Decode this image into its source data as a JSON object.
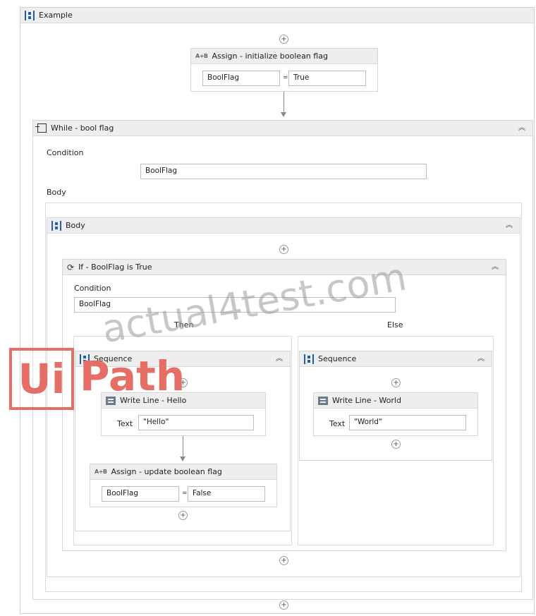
{
  "root": {
    "title": "Example"
  },
  "assign_init": {
    "title": "Assign - initialize boolean flag",
    "to": "BoolFlag",
    "value": "True"
  },
  "while": {
    "title": "While - bool flag",
    "condition_label": "Condition",
    "condition": "BoolFlag",
    "body_label": "Body"
  },
  "body_seq": {
    "title": "Body"
  },
  "if": {
    "title": "If - BoolFlag is True",
    "condition_label": "Condition",
    "condition": "BoolFlag",
    "then_label": "Then",
    "else_label": "Else"
  },
  "then_seq": {
    "title": "Sequence"
  },
  "write_hello": {
    "title": "Write Line - Hello",
    "text_label": "Text",
    "text": "\"Hello\""
  },
  "assign_update": {
    "title": "Assign - update boolean flag",
    "to": "BoolFlag",
    "value": "False"
  },
  "else_seq": {
    "title": "Sequence"
  },
  "write_world": {
    "title": "Write Line - World",
    "text_label": "Text",
    "text": "\"World\""
  },
  "watermark": {
    "site": "actual4test.com",
    "logo_ui": "Ui",
    "logo_path": "Path"
  },
  "icons": {
    "sequence": "sequence-icon",
    "assign": "assign-icon",
    "while": "while-icon",
    "if": "if-icon",
    "write_line": "write-line-icon",
    "collapse": "collapse-icon",
    "add": "add-activity-icon"
  },
  "colors": {
    "header_bg": "#eeeeee",
    "border": "#d6d6d6",
    "accent": "#1f5fa8",
    "logo": "#e56f66"
  }
}
